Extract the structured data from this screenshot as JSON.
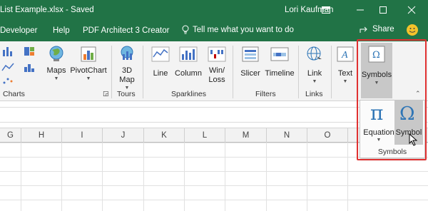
{
  "window": {
    "title": "List Example.xlsx  -  Saved",
    "user": "Lori Kaufman"
  },
  "tabs": {
    "items": [
      "Developer",
      "Help",
      "PDF Architect 3 Creator"
    ],
    "tellme": "Tell me what you want to do",
    "share": "Share"
  },
  "ribbon": {
    "maps": "Maps",
    "pivotchart": "PivotChart",
    "map3d_line1": "3D",
    "map3d_line2": "Map",
    "line": "Line",
    "column": "Column",
    "winloss_line1": "Win/",
    "winloss_line2": "Loss",
    "slicer": "Slicer",
    "timeline": "Timeline",
    "link": "Link",
    "text": "Text",
    "symbols": "Symbols",
    "groups": {
      "charts": "Charts",
      "tours": "Tours",
      "sparklines": "Sparklines",
      "filters": "Filters",
      "links": "Links"
    }
  },
  "popup": {
    "equation": "Equation",
    "symbol": "Symbol",
    "group": "Symbols"
  },
  "columns": [
    "G",
    "H",
    "I",
    "J",
    "K",
    "L",
    "M",
    "N",
    "O"
  ],
  "colors": {
    "accent": "#217346",
    "highlight": "#e03131"
  }
}
